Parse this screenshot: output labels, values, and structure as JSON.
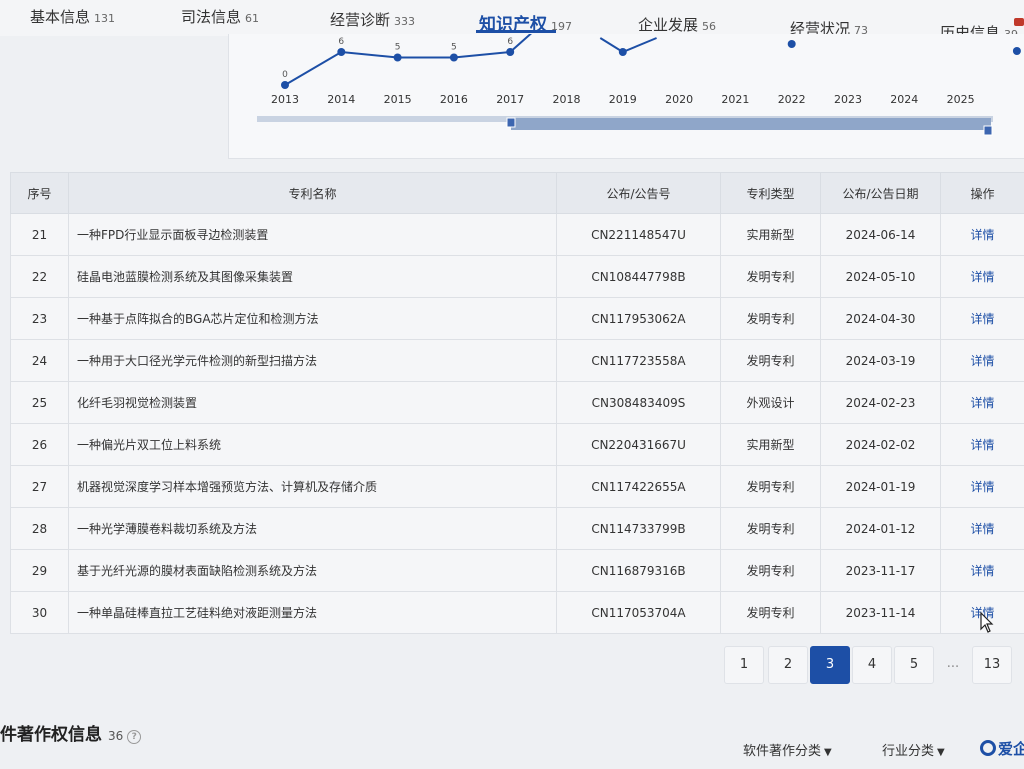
{
  "tabs": [
    {
      "label": "基本信息",
      "count": "131"
    },
    {
      "label": "司法信息",
      "count": "61"
    },
    {
      "label": "经营诊断",
      "count": "333"
    },
    {
      "label": "知识产权",
      "count": "197"
    },
    {
      "label": "企业发展",
      "count": "56"
    },
    {
      "label": "经营状况",
      "count": "73"
    },
    {
      "label": "历史信息",
      "count": "39"
    }
  ],
  "chart_data": {
    "type": "line",
    "x": [
      "2013",
      "2014",
      "2015",
      "2016",
      "2017",
      "2018",
      "2019",
      "2020",
      "2021",
      "2022",
      "2023",
      "2024",
      "2025"
    ],
    "visible_labels": [
      "0",
      "6",
      "5",
      "5",
      "6"
    ],
    "values_visible": [
      0,
      6,
      5,
      5,
      6
    ],
    "color": "#1d4fa6"
  },
  "table": {
    "headers": [
      "序号",
      "专利名称",
      "公布/公告号",
      "专利类型",
      "公布/公告日期",
      "操作"
    ],
    "rows": [
      [
        "21",
        "一种FPD行业显示面板寻边检测装置",
        "CN221148547U",
        "实用新型",
        "2024-06-14",
        "详情"
      ],
      [
        "22",
        "硅晶电池蓝膜检测系统及其图像采集装置",
        "CN108447798B",
        "发明专利",
        "2024-05-10",
        "详情"
      ],
      [
        "23",
        "一种基于点阵拟合的BGA芯片定位和检测方法",
        "CN117953062A",
        "发明专利",
        "2024-04-30",
        "详情"
      ],
      [
        "24",
        "一种用于大口径光学元件检测的新型扫描方法",
        "CN117723558A",
        "发明专利",
        "2024-03-19",
        "详情"
      ],
      [
        "25",
        "化纤毛羽视觉检测装置",
        "CN308483409S",
        "外观设计",
        "2024-02-23",
        "详情"
      ],
      [
        "26",
        "一种偏光片双工位上料系统",
        "CN220431667U",
        "实用新型",
        "2024-02-02",
        "详情"
      ],
      [
        "27",
        "机器视觉深度学习样本增强预览方法、计算机及存储介质",
        "CN117422655A",
        "发明专利",
        "2024-01-19",
        "详情"
      ],
      [
        "28",
        "一种光学薄膜卷料裁切系统及方法",
        "CN114733799B",
        "发明专利",
        "2024-01-12",
        "详情"
      ],
      [
        "29",
        "基于光纤光源的膜材表面缺陷检测系统及方法",
        "CN116879316B",
        "发明专利",
        "2023-11-17",
        "详情"
      ],
      [
        "30",
        "一种单晶硅棒直拉工艺硅料绝对液距测量方法",
        "CN117053704A",
        "发明专利",
        "2023-11-14",
        "详情"
      ]
    ]
  },
  "pagination": {
    "pages": [
      "1",
      "2",
      "3",
      "4",
      "5",
      "...",
      "13"
    ],
    "current": "3"
  },
  "section": {
    "title": "件著作权信息",
    "count": "36",
    "help": "?",
    "dropdown1": "软件著作分类",
    "dropdown2": "行业分类",
    "logo_text": "爱企"
  }
}
